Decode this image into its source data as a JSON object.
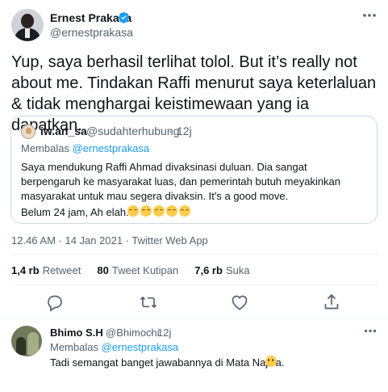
{
  "tweet": {
    "author_name": "Ernest Prakasa",
    "author_handle": "@ernestprakasa",
    "text": "Yup, saya berhasil terlihat tolol. But it’s really not about me. Tindakan Raffi menurut saya keterlaluan & tidak menghargai keistimewaan yang ia dapatkan.",
    "meta": "12.46 AM · 14 Jan 2021 · Twitter Web App"
  },
  "quote": {
    "name": "iw.an_sa",
    "handle": "@sudahterhubung",
    "dot": "·",
    "time": "12j",
    "reply_prefix": "Membalas ",
    "reply_mention": "@ernestprakasa",
    "body": "Saya mendukung Raffi Ahmad divaksinasi duluan. Dia sangat berpengaruh ke masyarakat luas, dan pemerintah butuh meyakinkan masyarakat untuk mau segera divaksin. It's a good move.",
    "tail": "Belum 24 jam, Ah elah."
  },
  "stats": {
    "retweets_count": "1,4 rb",
    "retweets_label": "Retweet",
    "quotes_count": "80",
    "quotes_label": "Tweet Kutipan",
    "likes_count": "7,6 rb",
    "likes_label": "Suka"
  },
  "actions": {
    "icons": [
      "reply-icon",
      "retweet-icon",
      "like-icon",
      "share-icon"
    ]
  },
  "reply": {
    "name": "Bhimo S.H",
    "handle": "@Bhimochi",
    "dot": "·",
    "time": "12j",
    "reply_prefix": "Membalas ",
    "reply_mention": "@ernestprakasa",
    "text": "Tadi semangat banget jawabannya di Mata Najwa."
  },
  "colors": {
    "accent": "#1d9bf0",
    "secondary_text": "#536471",
    "primary_text": "#0f1419",
    "border": "#cfd9de"
  }
}
